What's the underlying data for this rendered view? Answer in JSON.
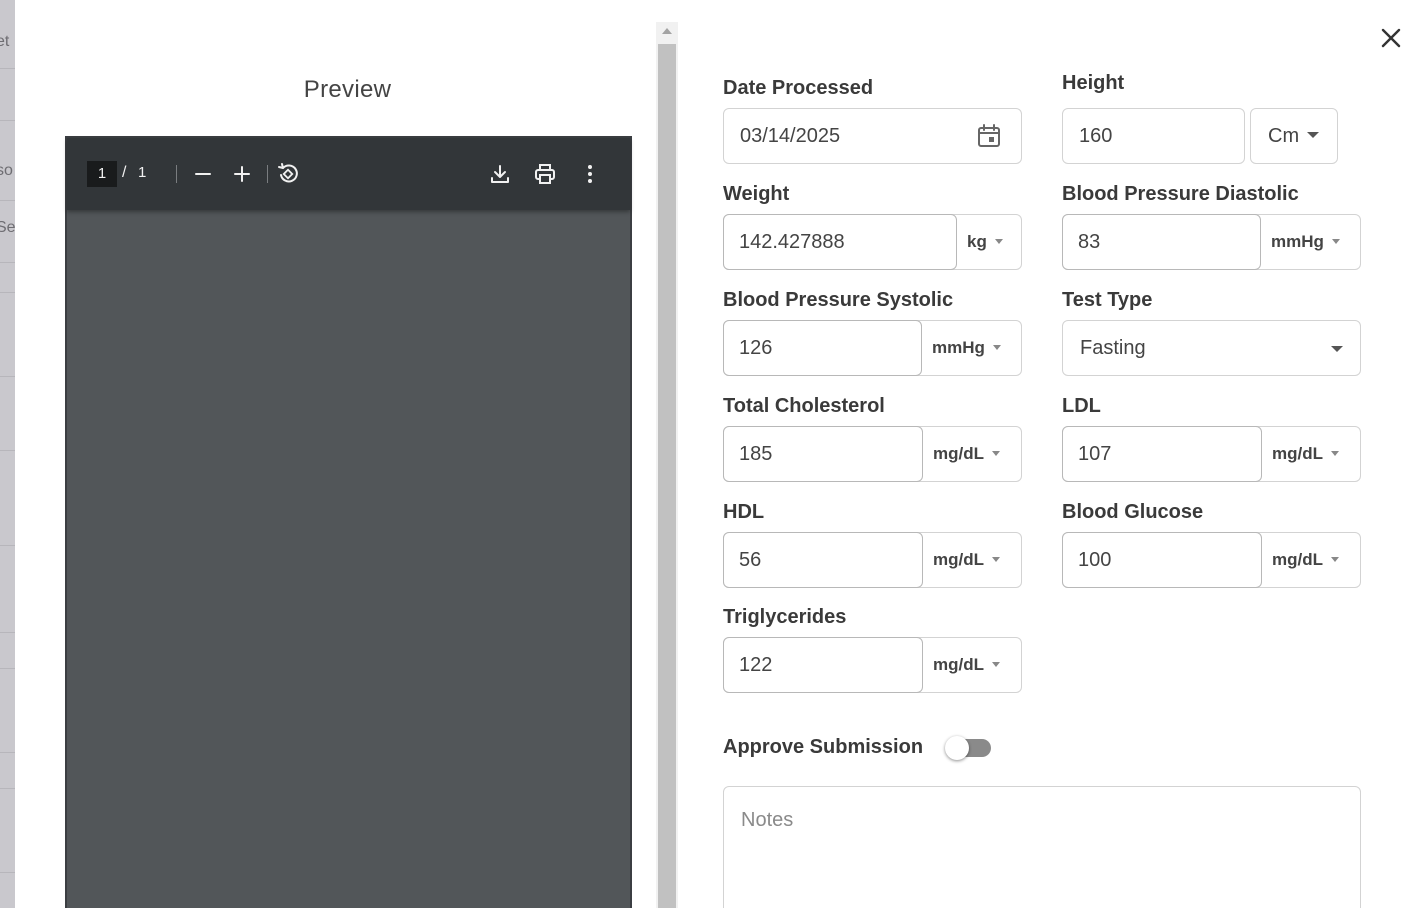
{
  "background": {
    "fragments": [
      "et",
      "so",
      "Se"
    ]
  },
  "preview": {
    "title": "Preview",
    "pdf_toolbar": {
      "current_page": "1",
      "separator": "/",
      "total_pages": "1"
    }
  },
  "form": {
    "date_processed": {
      "label": "Date Processed",
      "value": "03/14/2025"
    },
    "height": {
      "label": "Height",
      "value": "160",
      "unit": "Cm"
    },
    "weight": {
      "label": "Weight",
      "value": "142.427888",
      "unit": "kg"
    },
    "bp_diastolic": {
      "label": "Blood Pressure Diastolic",
      "value": "83",
      "unit": "mmHg"
    },
    "bp_systolic": {
      "label": "Blood Pressure Systolic",
      "value": "126",
      "unit": "mmHg"
    },
    "test_type": {
      "label": "Test Type",
      "value": "Fasting"
    },
    "total_cholesterol": {
      "label": "Total Cholesterol",
      "value": "185",
      "unit": "mg/dL"
    },
    "ldl": {
      "label": "LDL",
      "value": "107",
      "unit": "mg/dL"
    },
    "hdl": {
      "label": "HDL",
      "value": "56",
      "unit": "mg/dL"
    },
    "blood_glucose": {
      "label": "Blood Glucose",
      "value": "100",
      "unit": "mg/dL"
    },
    "triglycerides": {
      "label": "Triglycerides",
      "value": "122",
      "unit": "mg/dL"
    },
    "approve": {
      "label": "Approve Submission",
      "checked": false
    },
    "notes": {
      "placeholder": "Notes",
      "value": ""
    }
  },
  "icons": {
    "close": "close-icon",
    "calendar": "calendar-icon",
    "zoom_out": "minus-icon",
    "zoom_in": "plus-icon",
    "rotate": "rotate-icon",
    "download": "download-icon",
    "print": "print-icon",
    "more": "more-vertical-icon"
  },
  "colors": {
    "pdf_toolbar": "#323639",
    "pdf_canvas": "#525659",
    "toggle_off": "#8a8a8a"
  }
}
